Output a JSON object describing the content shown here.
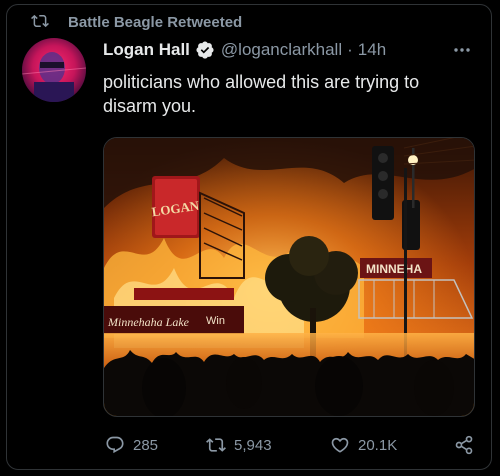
{
  "retweet": {
    "text": "Battle Beagle Retweeted",
    "icon": "retweet-icon"
  },
  "author": {
    "name": "Logan Hall",
    "handle": "@loganclarkhall",
    "separator": "·",
    "time": "14h",
    "verified": true
  },
  "tweet": {
    "text": "politicians who allowed this are trying to disarm you."
  },
  "media": {
    "signs": {
      "store": "LOGAN",
      "lake": "Minnehaha Lake",
      "win": "Win",
      "minnehaha": "MINNEHA"
    }
  },
  "actions": {
    "replies": "285",
    "retweets": "5,943",
    "likes": "20.1K"
  },
  "colors": {
    "muted": "#8b98a5",
    "text": "#e7e9ea",
    "verified": "#1d9bf0",
    "background": "#000000"
  }
}
